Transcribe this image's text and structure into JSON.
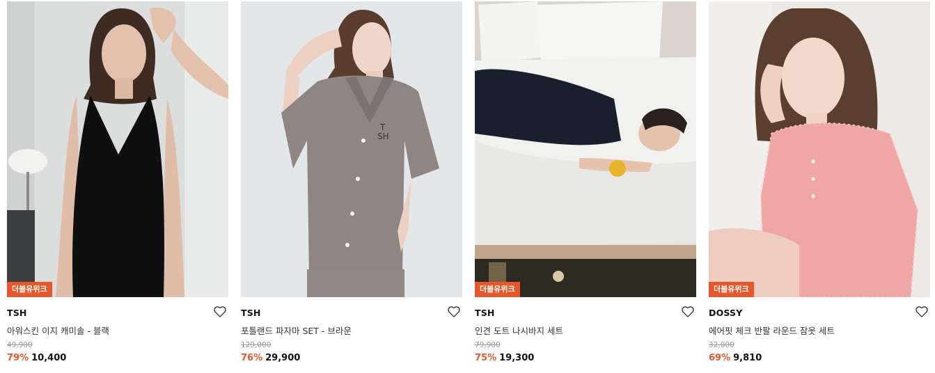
{
  "products": [
    {
      "badge": "더블유위크",
      "brand": "TSH",
      "name": "아워스킨 이지 캐미솔 - 블랙",
      "original_price": "49,900",
      "discount": "79%",
      "price": "10,400"
    },
    {
      "badge": "",
      "brand": "TSH",
      "name": "포틀랜드 파자마 SET - 브라운",
      "original_price": "129,000",
      "discount": "76%",
      "price": "29,900"
    },
    {
      "badge": "더블유위크",
      "brand": "TSH",
      "name": "인견 도트 나시바지 세트",
      "original_price": "79,900",
      "discount": "75%",
      "price": "19,300"
    },
    {
      "badge": "더블유위크",
      "brand": "DOSSY",
      "name": "에어핏 체크 반팔 라운드 잠옷 세트",
      "original_price": "32,000",
      "discount": "69%",
      "price": "9,810"
    }
  ],
  "colors": {
    "badge_bg": "#e8572a",
    "discount": "#e8572a"
  },
  "icons": {
    "wishlist": "heart-outline-icon"
  }
}
